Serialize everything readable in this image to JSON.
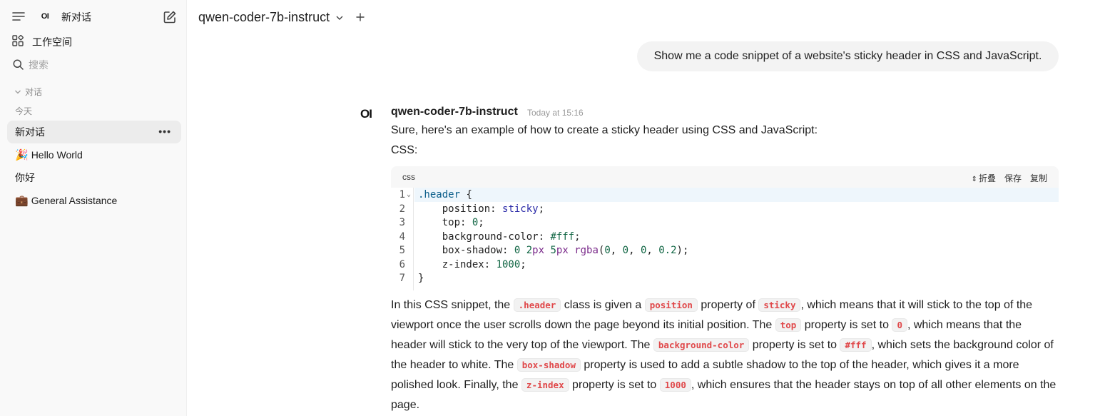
{
  "sidebar": {
    "logo_text": "OI",
    "title": "新对话",
    "workspace_label": "工作空间",
    "search_placeholder": "搜索",
    "section_label": "对话",
    "group_today": "今天",
    "chats": [
      {
        "emoji": "",
        "label": "新对话",
        "active": true,
        "more": "•••"
      },
      {
        "emoji": "🎉",
        "label": "Hello World",
        "active": false
      },
      {
        "emoji": "",
        "label": "你好",
        "active": false
      },
      {
        "emoji": "💼",
        "label": "General Assistance",
        "active": false
      }
    ]
  },
  "topbar": {
    "model_name": "qwen-coder-7b-instruct"
  },
  "user_message": "Show me a code snippet of a website's sticky header in CSS and JavaScript.",
  "assistant": {
    "avatar_text": "OI",
    "name": "qwen-coder-7b-instruct",
    "time": "Today at 15:16",
    "intro": "Sure, here's an example of how to create a sticky header using CSS and JavaScript:",
    "css_label": "CSS:",
    "code": {
      "lang": "css",
      "fold_label": "折叠",
      "save_label": "保存",
      "copy_label": "复制",
      "line_numbers": [
        "1",
        "2",
        "3",
        "4",
        "5",
        "6",
        "7"
      ]
    },
    "para": {
      "t1": "In this CSS snippet, the ",
      "c1": ".header",
      "t2": " class is given a ",
      "c2": "position",
      "t3": " property of ",
      "c3": "sticky",
      "t4": ", which means that it will stick to the top of the viewport once the user scrolls down the page beyond its initial position. The ",
      "c4": "top",
      "t5": " property is set to ",
      "c5": "0",
      "t6": ", which means that the header will stick to the very top of the viewport. The ",
      "c6": "background-color",
      "t7": " property is set to ",
      "c7": "#fff",
      "t8": ", which sets the background color of the header to white. The ",
      "c8": "box-shadow",
      "t9": " property is used to add a subtle shadow to the top of the header, which gives it a more polished look. Finally, the ",
      "c9": "z-index",
      "t10": " property is set to ",
      "c10": "1000",
      "t11": ", which ensures that the header stays on top of all other elements on the page."
    }
  }
}
